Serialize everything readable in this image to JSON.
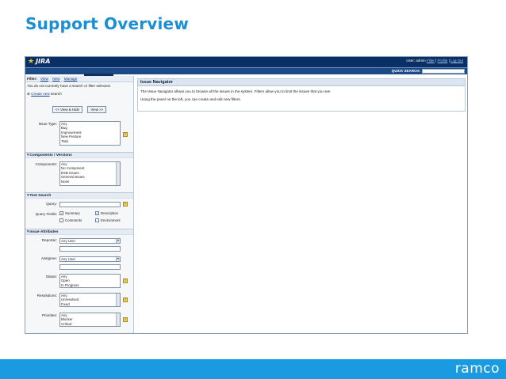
{
  "slide": {
    "title": "Support Overview",
    "logo": "ramco"
  },
  "jira": {
    "logo": "JIRA",
    "user_links": {
      "prefix": "User: admin",
      "items": [
        "Filter",
        "Profile",
        "Log Out"
      ]
    },
    "nav": [
      "HOME",
      "BROWSE PROJECT",
      "FIND ISSUES",
      "CREATE NEW ISSUE",
      "ADMINISTRATION"
    ],
    "quick_search_label": "QUICK SEARCH:"
  },
  "filter": {
    "label": "Filter:",
    "tabs": [
      "View",
      "New",
      "Manage"
    ],
    "message": "You do not currently have a search or filter selected.",
    "create_link": "Create new",
    "create_suffix": "search",
    "view_hide": "<< View & Hide",
    "view": "View >>"
  },
  "issue_type": {
    "label": "Issue Type:",
    "options": [
      "Any",
      "Bug",
      "Improvement",
      "New Feature",
      "Task"
    ]
  },
  "components_section": {
    "title": "Components / Versions",
    "label": "Components:",
    "options": [
      "Any",
      "No Component",
      "ESB Issues",
      "General Issues",
      "None"
    ]
  },
  "text_search": {
    "title": "Text Search",
    "query_label": "Query:",
    "fields_label": "Query Fields:",
    "fields": [
      {
        "label": "Summary",
        "checked": true
      },
      {
        "label": "Description",
        "checked": true
      },
      {
        "label": "Comments",
        "checked": false
      },
      {
        "label": "Environment",
        "checked": false
      }
    ]
  },
  "attributes": {
    "title": "Issue Attributes",
    "reporter_label": "Reporter:",
    "reporter_value": "Any User",
    "assignee_label": "Assignee:",
    "assignee_value": "Any User",
    "status_label": "Status:",
    "status_options": [
      "Any",
      "Open",
      "In Progress"
    ],
    "resolutions_label": "Resolutions:",
    "resolutions_options": [
      "Any",
      "Unresolved",
      "Fixed"
    ],
    "priorities_label": "Priorities:",
    "priorities_options": [
      "Any",
      "Blocker",
      "Critical"
    ]
  },
  "navigator": {
    "title": "Issue Navigator",
    "line1": "The Issue Navigator allows you to browse all the issues in the system. Filters allow you to limit the issues that you see.",
    "line2": "Using the panel on the left, you can create and edit new filters."
  }
}
